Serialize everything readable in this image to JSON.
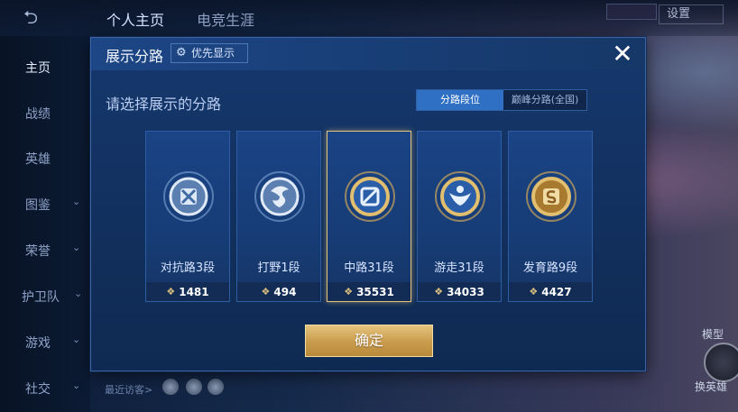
{
  "background": {
    "back_label": "⮌",
    "tabs": [
      "个人主页",
      "电竞生涯"
    ],
    "settings_label": "设置",
    "sidebar": [
      {
        "label": "主页",
        "chevron": ""
      },
      {
        "label": "战绩",
        "chevron": ""
      },
      {
        "label": "英雄",
        "chevron": ""
      },
      {
        "label": "图鉴",
        "chevron": "⌄"
      },
      {
        "label": "荣誉",
        "chevron": "⌄"
      },
      {
        "label": "护卫队",
        "chevron": "⌄"
      },
      {
        "label": "游戏",
        "chevron": "⌄"
      },
      {
        "label": "社交",
        "chevron": "⌄"
      }
    ],
    "visitors_label": "最近访客>",
    "right_label_top": "模型",
    "right_label_bottom": "换英雄"
  },
  "modal": {
    "title": "展示分路",
    "priority_label": "优先显示",
    "close_label": "✕",
    "subtitle": "请选择展示的分路",
    "segments": [
      "分路段位",
      "巅峰分路(全国)"
    ],
    "active_segment": 0,
    "lanes": [
      {
        "name": "对抗路3段",
        "score": "1481",
        "icon": "clash-lane-emblem-icon",
        "tier": "silver"
      },
      {
        "name": "打野1段",
        "score": "494",
        "icon": "jungle-emblem-icon",
        "tier": "silver"
      },
      {
        "name": "中路31段",
        "score": "35531",
        "icon": "mid-lane-emblem-icon",
        "tier": "gold"
      },
      {
        "name": "游走31段",
        "score": "34033",
        "icon": "roam-emblem-icon",
        "tier": "gold"
      },
      {
        "name": "发育路9段",
        "score": "4427",
        "icon": "farm-lane-emblem-icon",
        "tier": "gold"
      }
    ],
    "selected_lane": 2,
    "confirm_label": "确定"
  },
  "colors": {
    "modal_bg": "#16386e",
    "accent_blue": "#2f6fc4",
    "gold": "#e3c47a"
  }
}
